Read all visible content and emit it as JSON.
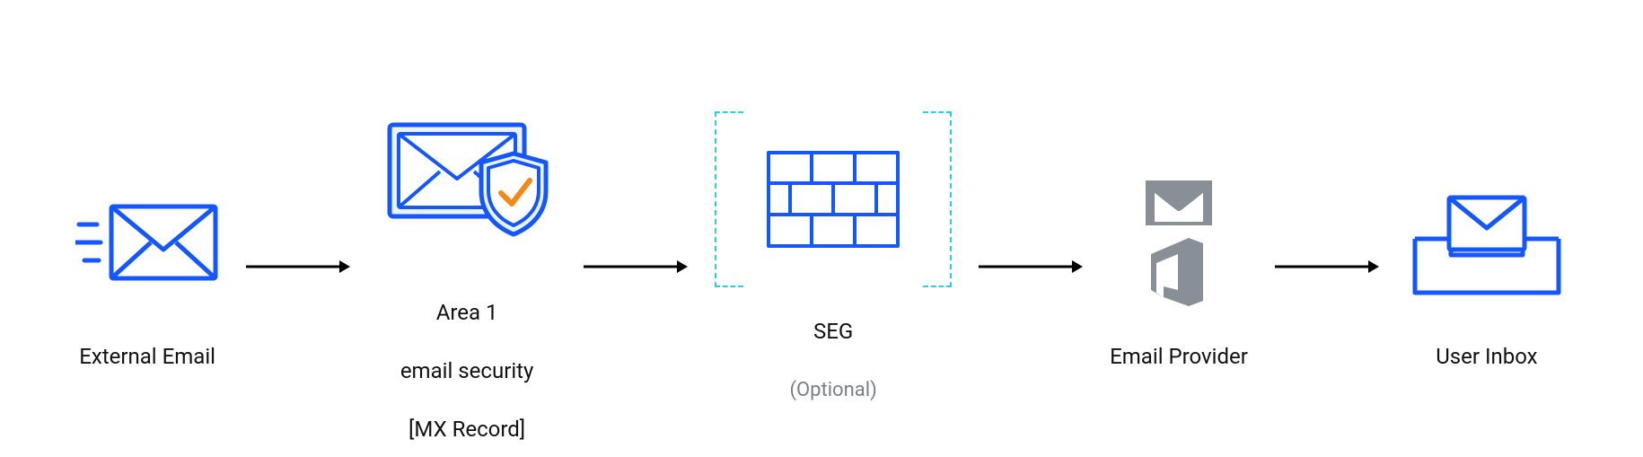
{
  "colors": {
    "stroke": "#1557ff",
    "envelope_fill": "#ffffff",
    "shield_fill": "#eaf3fa",
    "shield_inner": "#ffffff",
    "check": "#f28a1a",
    "arrow": "#000000",
    "dashed": "#2bd0e3",
    "provider_gray": "#888f96",
    "optional_text": "#7a7f87"
  },
  "nodes": {
    "external": {
      "label": "External Email",
      "icon": "incoming-email-icon"
    },
    "area1": {
      "label_l1": "Area 1",
      "label_l2": "email security",
      "label_l3": "[MX Record]",
      "icon": "shielded-email-icon"
    },
    "seg": {
      "label": "SEG",
      "sub": "(Optional)",
      "icon": "firewall-icon"
    },
    "provider": {
      "label": "Email Provider",
      "icon": "email-provider-icons"
    },
    "inbox": {
      "label": "User Inbox",
      "icon": "inbox-icon"
    }
  }
}
